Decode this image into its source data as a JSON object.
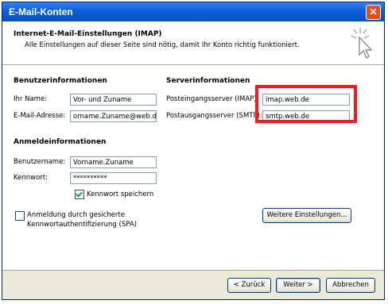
{
  "window": {
    "title": "E-Mail-Konten"
  },
  "header": {
    "title": "Internet-E-Mail-Einstellungen (IMAP)",
    "subtitle": "Alle Einstellungen auf dieser Seite sind nötig, damit Ihr Konto richtig funktioniert."
  },
  "user_info": {
    "heading": "Benutzerinformationen",
    "name_label": "Ihr Name:",
    "name_value": "Vor- und Zuname",
    "email_label": "E-Mail-Adresse:",
    "email_value": "orname.Zuname@web.de"
  },
  "server_info": {
    "heading": "Serverinformationen",
    "incoming_label": "Posteingangsserver (IMAP):",
    "incoming_value": "imap.web.de",
    "outgoing_label": "Postausgangsserver (SMTP):",
    "outgoing_value": "smtp.web.de"
  },
  "login_info": {
    "heading": "Anmeldeinformationen",
    "username_label": "Benutzername:",
    "username_value": "Vorname.Zuname",
    "password_label": "Kennwort:",
    "password_value": "**********",
    "save_password_label": "Kennwort speichern",
    "save_password_checked": true,
    "spa_label_line1": "Anmeldung durch gesicherte",
    "spa_label_line2": "Kennwortauthentifizierung (SPA)",
    "spa_checked": false
  },
  "buttons": {
    "more_settings": "Weitere Einstellungen...",
    "back": "< Zurück",
    "next": "Weiter >",
    "cancel": "Abbrechen"
  },
  "colors": {
    "titlebar": "#0a5fd8",
    "highlight": "#ee1c1c",
    "dialog_bg": "#ece9d8"
  }
}
